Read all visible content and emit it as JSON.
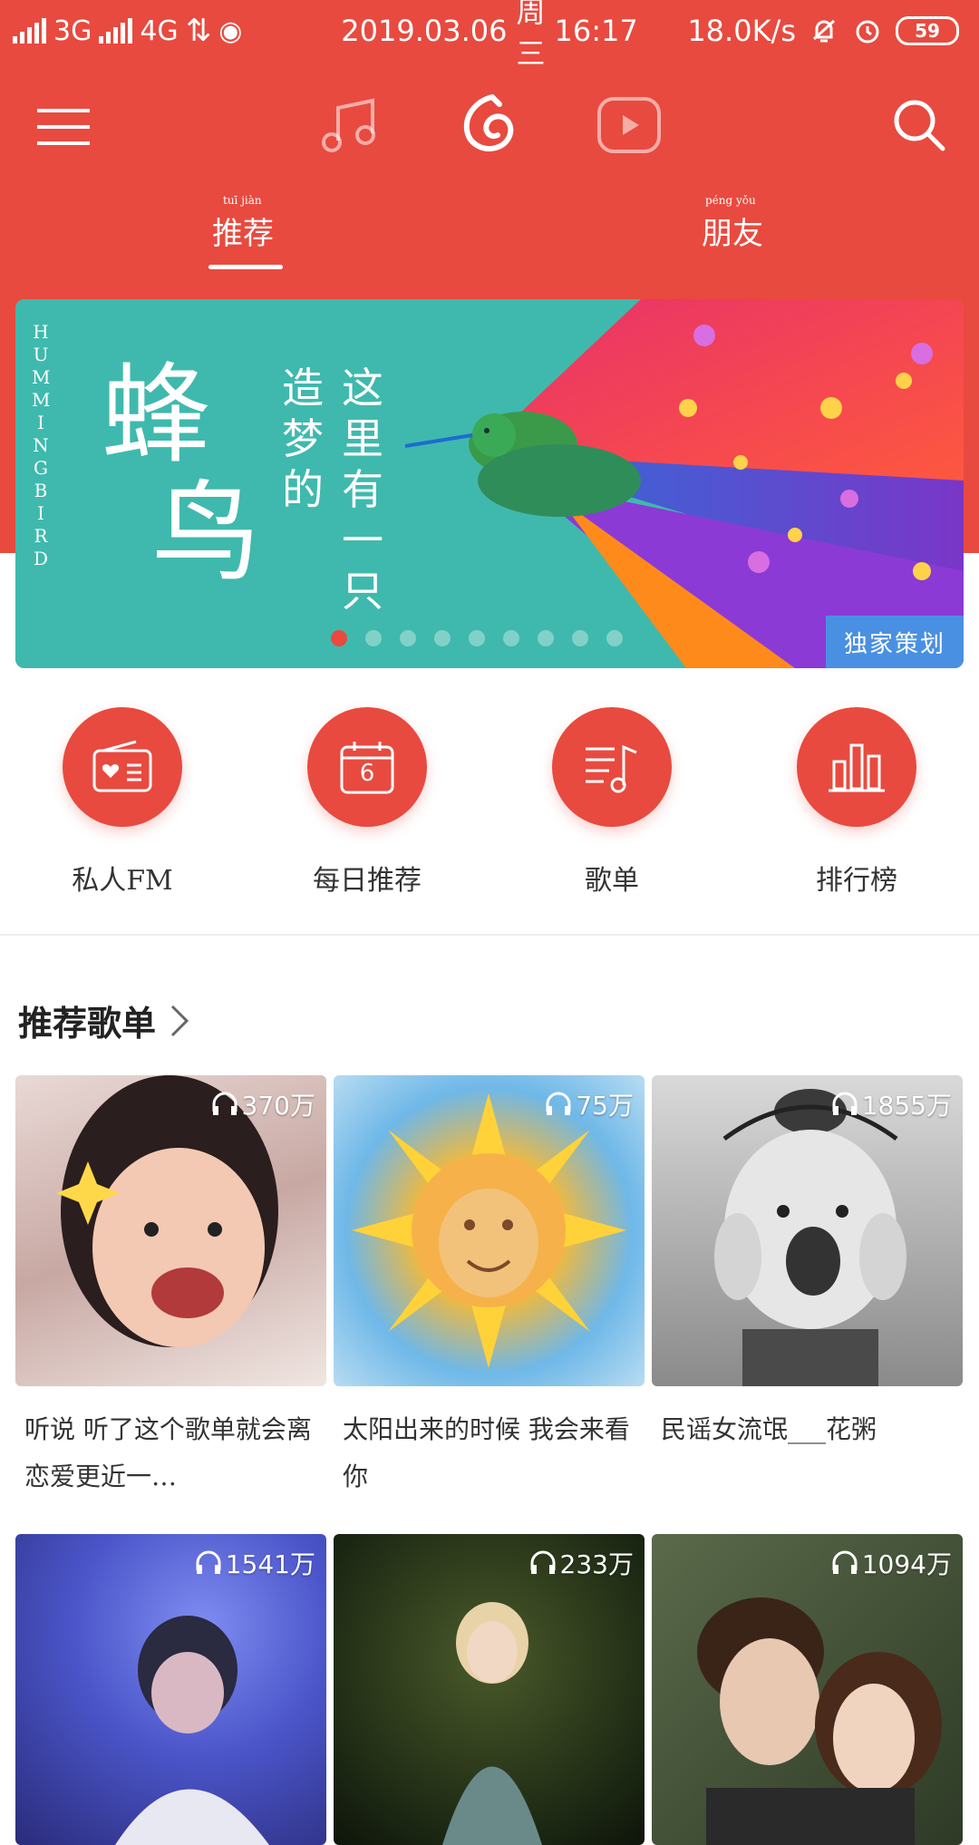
{
  "status": {
    "network1": "3G",
    "network2": "4G",
    "datetime": "2019.03.06",
    "weekday": "周三",
    "time": "16:17",
    "speed": "18.0K/s",
    "battery": "59"
  },
  "nav": {
    "icons": [
      "menu-icon",
      "music-icon",
      "netease-logo-icon",
      "video-icon",
      "search-icon"
    ]
  },
  "tabs": [
    {
      "label": "推荐",
      "pinyin": "tuī jiàn"
    },
    {
      "label": "朋友",
      "pinyin": "péng yǒu"
    }
  ],
  "banner": {
    "vertical_text": "HUMMINGBIRD",
    "title_1": "蜂",
    "title_2": "鸟",
    "line_1": "造梦的",
    "line_2": "这里有一只",
    "tag": "独家策划",
    "dot_count": 9,
    "active_dot": 0
  },
  "quick_entries": [
    {
      "label": "私人FM",
      "icon": "radio-icon"
    },
    {
      "label": "每日推荐",
      "icon": "calendar-icon",
      "day": "6"
    },
    {
      "label": "歌单",
      "icon": "playlist-icon"
    },
    {
      "label": "排行榜",
      "icon": "chart-icon"
    }
  ],
  "section": {
    "title": "推荐歌单"
  },
  "playlists": [
    {
      "plays": "370万",
      "title": "听说 听了这个歌单就会离恋爱更近一…"
    },
    {
      "plays": "75万",
      "title": "太阳出来的时候 我会来看你"
    },
    {
      "plays": "1855万",
      "title": "民谣女流氓___花粥"
    },
    {
      "plays": "1541万",
      "title": ""
    },
    {
      "plays": "233万",
      "title": ""
    },
    {
      "plays": "1094万",
      "title": ""
    }
  ],
  "colors": {
    "brand_red": "#e84a3f",
    "tag_blue": "#4a90e2",
    "banner_teal": "#3fb9ad"
  }
}
